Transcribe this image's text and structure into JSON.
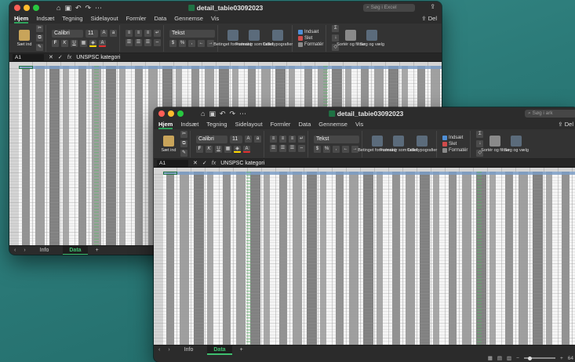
{
  "windows": [
    {
      "id": "back",
      "title": "detail_tabie03092023",
      "search_placeholder": "Søg i Excel",
      "share_label": "Del",
      "tabs": [
        "Hjem",
        "Indsæt",
        "Tegning",
        "Sidelayout",
        "Formler",
        "Data",
        "Gennemse",
        "Vis"
      ],
      "active_tab": "Hjem",
      "ribbon": {
        "paste_label": "Sæt ind",
        "font_name": "Calibri",
        "font_size": "11",
        "number_format": "Tekst",
        "cond_format_label": "Betinget formatering",
        "table_format_label": "Formatér som tabel",
        "cell_styles_label": "Celletypografier",
        "insert_label": "Indsæt",
        "delete_label": "Slet",
        "format_label": "Formatér",
        "sort_label": "Sortér og filtrer",
        "find_label": "Søg og vælg"
      },
      "name_box": "A1",
      "formula_content": "UNSPSC kategori",
      "sheets": [
        "Info",
        "Data"
      ],
      "active_sheet": "Data"
    },
    {
      "id": "front",
      "title": "detail_tabie03092023",
      "search_placeholder": "Søg i ark",
      "share_label": "Del",
      "tabs": [
        "Hjem",
        "Indsæt",
        "Tegning",
        "Sidelayout",
        "Formler",
        "Data",
        "Gennemse",
        "Vis"
      ],
      "active_tab": "Hjem",
      "ribbon": {
        "paste_label": "Sæt ind",
        "font_name": "Calibri",
        "font_size": "11",
        "number_format": "Tekst",
        "cond_format_label": "Betinget formatering",
        "table_format_label": "Formatér som tabel",
        "cell_styles_label": "Celletypografier",
        "insert_label": "Indsæt",
        "delete_label": "Slet",
        "format_label": "Formatér",
        "sort_label": "Sortér og filtrer",
        "find_label": "Søg og vælg"
      },
      "name_box": "A1",
      "formula_content": "UNSPSC kategori",
      "sheets": [
        "Info",
        "Data"
      ],
      "active_sheet": "Data",
      "zoom": "64"
    }
  ],
  "colors": {
    "excel_green": "#1f7244",
    "active_sheet_green": "#3fbf6f",
    "desktop": "#2b7a78"
  }
}
